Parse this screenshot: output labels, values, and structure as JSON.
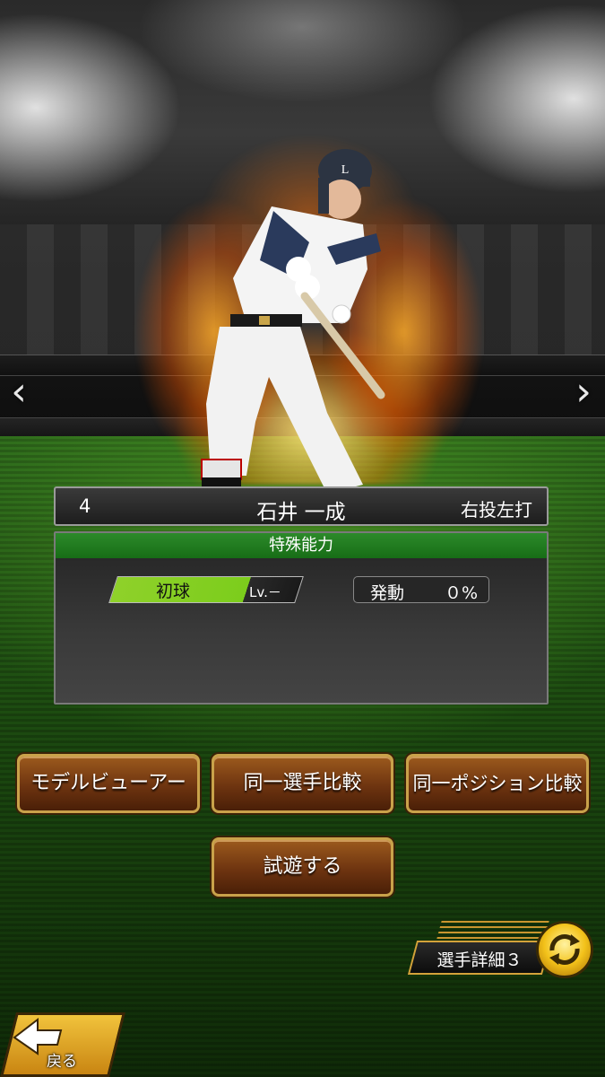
{
  "player": {
    "number": "4",
    "name": "石井 一成",
    "handedness": "右投左打"
  },
  "special_ability": {
    "header": "特殊能力",
    "skill_name": "初球",
    "skill_level": "Lv.－",
    "activation_label": "発動",
    "activation_value": "０%"
  },
  "buttons": {
    "model_viewer": "モデルビューアー",
    "same_player_compare": "同一選手比較",
    "same_position_compare": "同一ポジション比較",
    "try_play": "試遊する"
  },
  "footer": {
    "detail_label": "選手詳細３",
    "back_label": "戻る"
  },
  "icons": {
    "nav_left": "chevron-left-icon",
    "nav_right": "chevron-right-icon",
    "switch": "cycle-arrows-icon",
    "back": "back-arrow-icon"
  },
  "colors": {
    "ability_header": "#176d16",
    "skill_bar": "#8fd12a",
    "button_brown": "#6e3410",
    "gold": "#d4a23a"
  }
}
